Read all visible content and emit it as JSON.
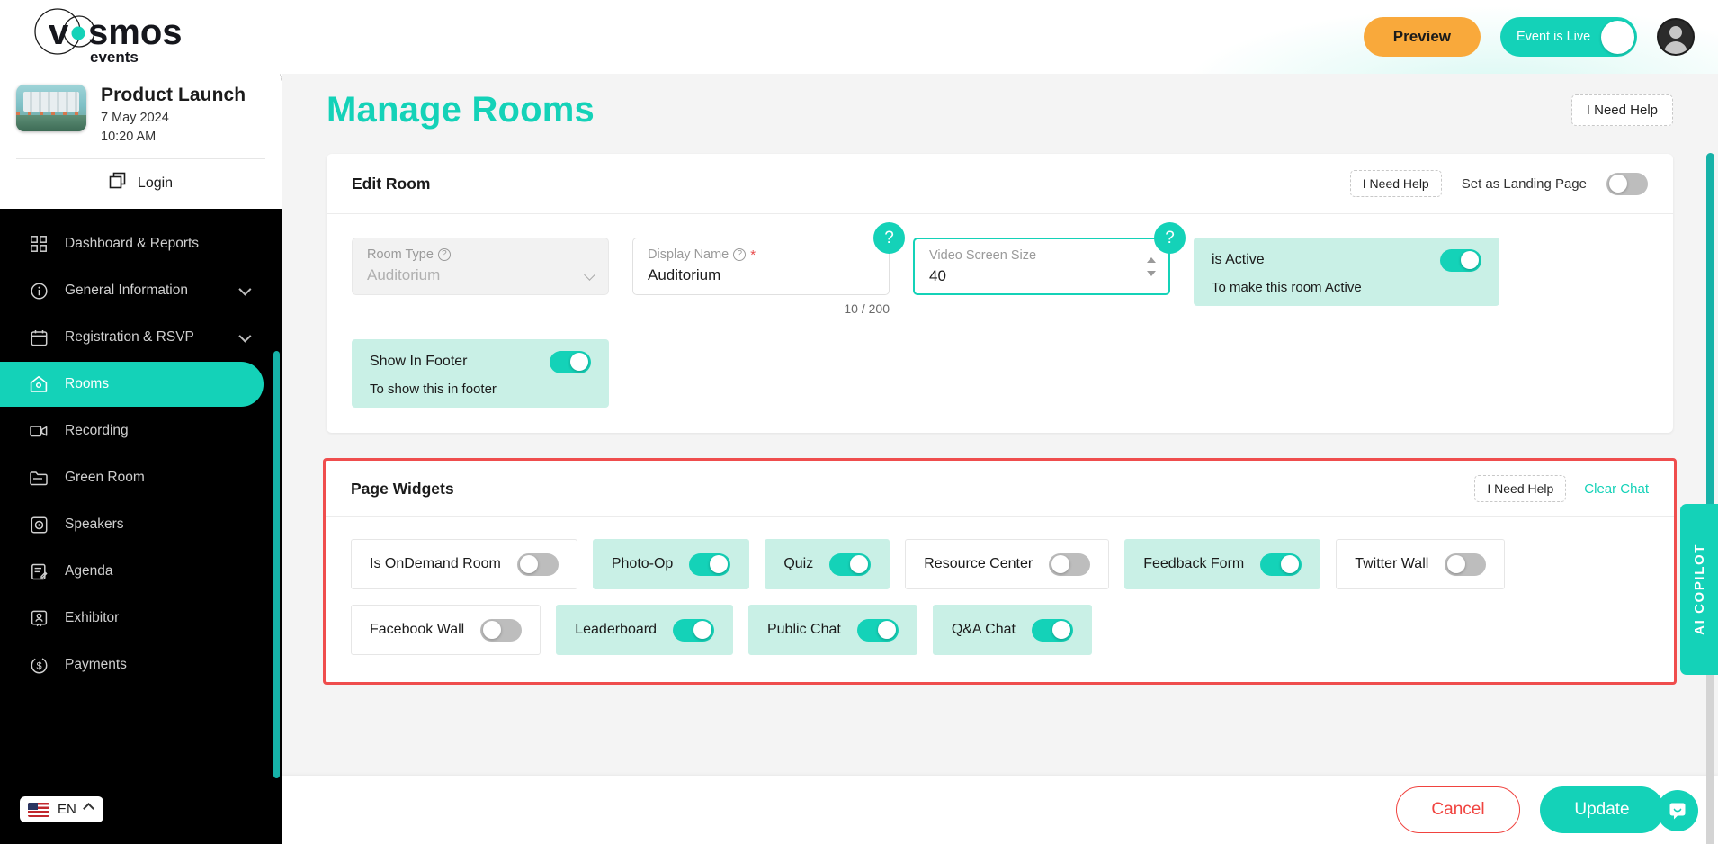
{
  "brand": {
    "name": "vosmos",
    "subtitle": "events",
    "accent": "#14D2B8",
    "orange": "#F9A93B",
    "red": "#ef4d4d"
  },
  "topbar": {
    "preview_label": "Preview",
    "live_toggle_label": "Event is Live",
    "live_toggle_state": "on",
    "avatar_name": "user-avatar"
  },
  "sidebar": {
    "event": {
      "name": "Product Launch",
      "date": "7 May 2024",
      "time": "10:20 AM"
    },
    "login_label": "Login",
    "items": [
      {
        "label": "Dashboard & Reports",
        "icon": "grid-icon",
        "active": false,
        "expandable": false
      },
      {
        "label": "General Information",
        "icon": "info-icon",
        "active": false,
        "expandable": true
      },
      {
        "label": "Registration & RSVP",
        "icon": "calendar-icon",
        "active": false,
        "expandable": true
      },
      {
        "label": "Rooms",
        "icon": "home-icon",
        "active": true,
        "expandable": false
      },
      {
        "label": "Recording",
        "icon": "video-icon",
        "active": false,
        "expandable": false
      },
      {
        "label": "Green Room",
        "icon": "folder-icon",
        "active": false,
        "expandable": false
      },
      {
        "label": "Speakers",
        "icon": "speaker-icon",
        "active": false,
        "expandable": false
      },
      {
        "label": "Agenda",
        "icon": "agenda-icon",
        "active": false,
        "expandable": false
      },
      {
        "label": "Exhibitor",
        "icon": "exhibitor-icon",
        "active": false,
        "expandable": false
      },
      {
        "label": "Payments",
        "icon": "dollar-icon",
        "active": false,
        "expandable": false
      }
    ],
    "language": "EN"
  },
  "page": {
    "title": "Manage Rooms",
    "help_label": "I Need Help"
  },
  "edit_room": {
    "title": "Edit Room",
    "help_label": "I Need Help",
    "landing_label": "Set as Landing Page",
    "landing_state": "off",
    "fields": {
      "room_type": {
        "label": "Room Type",
        "value": "Auditorium",
        "disabled": true,
        "has_help_icon": true
      },
      "display_name": {
        "label": "Display Name",
        "value": "Auditorium",
        "required": true,
        "counter": "10 / 200",
        "has_help_icon": true
      },
      "video_screen_size": {
        "label": "Video Screen Size",
        "value": "40",
        "focused": true
      }
    },
    "is_active": {
      "label": "is Active",
      "sublabel": "To make this room Active",
      "state": "on"
    },
    "show_in_footer": {
      "label": "Show In Footer",
      "sublabel": "To show this in footer",
      "state": "on"
    },
    "help_bubble_glyph": "?"
  },
  "page_widgets": {
    "title": "Page Widgets",
    "help_label": "I Need Help",
    "clear_chat_label": "Clear Chat",
    "rows": [
      [
        {
          "label": "Is OnDemand Room",
          "state": "off"
        },
        {
          "label": "Photo-Op",
          "state": "on"
        },
        {
          "label": "Quiz",
          "state": "on"
        },
        {
          "label": "Resource Center",
          "state": "off"
        },
        {
          "label": "Feedback Form",
          "state": "on"
        },
        {
          "label": "Twitter Wall",
          "state": "off"
        }
      ],
      [
        {
          "label": "Facebook Wall",
          "state": "off"
        },
        {
          "label": "Leaderboard",
          "state": "on"
        },
        {
          "label": "Public Chat",
          "state": "on"
        },
        {
          "label": "Q&A Chat",
          "state": "on"
        }
      ]
    ]
  },
  "footer": {
    "cancel_label": "Cancel",
    "update_label": "Update"
  },
  "copilot": {
    "label": "AI COPILOT"
  }
}
